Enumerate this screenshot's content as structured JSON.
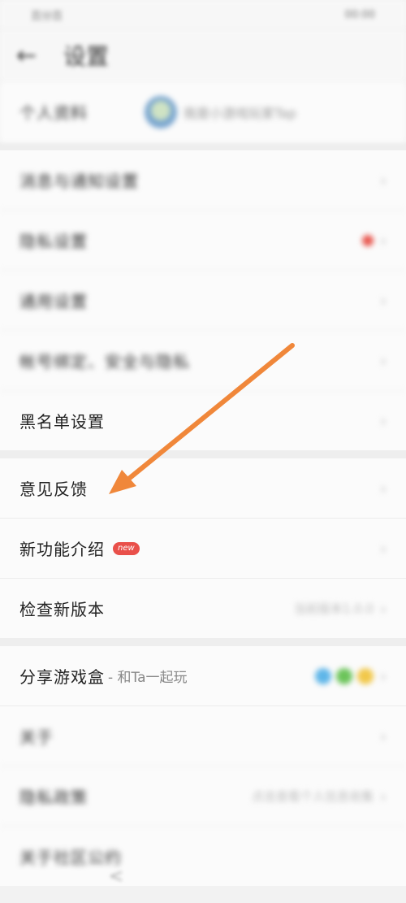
{
  "status": {
    "left": "百分百",
    "right": "00:00"
  },
  "header": {
    "back_icon": "back-arrow-icon",
    "title": "设置"
  },
  "profile": {
    "label": "个人资料",
    "value": "我是小游戏玩家Tap"
  },
  "sections": {
    "settings_a": [
      {
        "label": "消息与通知设置"
      },
      {
        "label": "隐私设置",
        "has_red_dot": true
      },
      {
        "label": "通用设置"
      },
      {
        "label": "帐号绑定、安全与隐私"
      },
      {
        "label": "黑名单设置"
      }
    ],
    "settings_b": [
      {
        "label": "意见反馈"
      },
      {
        "label": "新功能介绍",
        "badge": "new"
      },
      {
        "label": "检查新版本",
        "value": "当前版本1.0.0"
      }
    ],
    "settings_c": [
      {
        "label": "分享游戏盒",
        "suffix": "- 和Ta一起玩"
      },
      {
        "label": "关于"
      },
      {
        "label": "隐私政策",
        "value": "点击查看个人信息收集"
      },
      {
        "label": "关于社区公约"
      }
    ]
  },
  "chevron": "›",
  "colors": {
    "arrow": "#f0873a",
    "badge": "#e9504a",
    "red_dot": "#e8574f"
  },
  "share_icons": [
    "#5fb6e8",
    "#6cc45a",
    "#f1c84b"
  ]
}
